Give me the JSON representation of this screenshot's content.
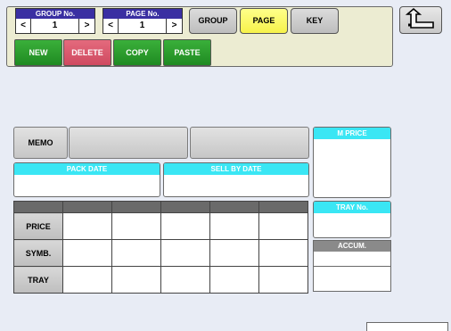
{
  "toolbar": {
    "group_nav": {
      "title": "GROUP No.",
      "prev": "<",
      "value": "1",
      "next": ">"
    },
    "page_nav": {
      "title": "PAGE No.",
      "prev": "<",
      "value": "1",
      "next": ">"
    },
    "mode_buttons": [
      {
        "label": "GROUP",
        "active": false
      },
      {
        "label": "PAGE",
        "active": true
      },
      {
        "label": "KEY",
        "active": false
      }
    ],
    "actions": {
      "new": "NEW",
      "delete": "DELETE",
      "copy": "COPY",
      "paste": "PASTE"
    }
  },
  "back_button": {
    "icon": "return-arrow-icon"
  },
  "form": {
    "memo_label": "MEMO",
    "pack_date": "PACK DATE",
    "sell_by_date": "SELL BY DATE",
    "m_price": "M PRICE",
    "tray_no": "TRAY No.",
    "accum": "ACCUM.",
    "rows": [
      "PRICE",
      "SYMB.",
      "TRAY"
    ]
  },
  "colors": {
    "nav_title": "#3a2fa2",
    "active_mode": "#f6f24a",
    "new": "#1f8a22",
    "delete": "#cf4a60",
    "field_header": "#3ae6f4"
  }
}
